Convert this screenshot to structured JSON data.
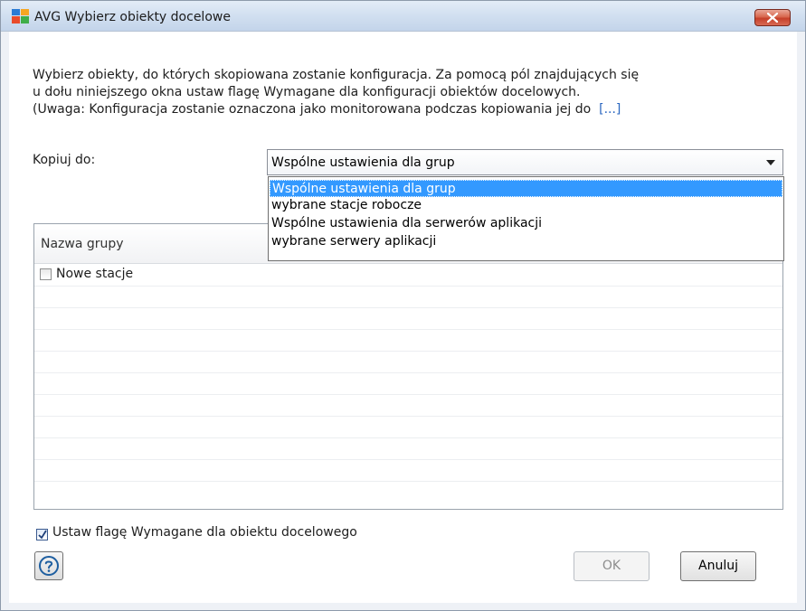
{
  "window": {
    "title": "AVG Wybierz obiekty docelowe"
  },
  "description": {
    "line1": "Wybierz obiekty, do których skopiowana zostanie konfiguracja. Za pomocą pól znajdujących się",
    "line2": "u dołu niniejszego okna ustaw flagę Wymagane dla konfiguracji obiektów docelowych.",
    "line3": "(Uwaga: Konfiguracja zostanie oznaczona jako monitorowana podczas kopiowania jej do",
    "more_link": "[...]"
  },
  "copy_to": {
    "label": "Kopiuj do:",
    "selected": "Wspólne ustawienia dla grup",
    "options": [
      "Wspólne ustawienia dla grup",
      "wybrane stacje robocze",
      "Wspólne ustawienia dla serwerów aplikacji",
      "wybrane serwery aplikacji"
    ]
  },
  "grid": {
    "column_header": "Nazwa grupy",
    "rows": [
      {
        "label": "Nowe stacje",
        "checked": false
      }
    ]
  },
  "flag_checkbox": {
    "label": "Ustaw flagę Wymagane dla obiektu docelowego",
    "checked": true
  },
  "buttons": {
    "ok": "OK",
    "cancel": "Anuluj"
  },
  "icons": {
    "app": "avg-logo-icon",
    "close": "close-icon",
    "help": "help-icon",
    "dropdown": "chevron-down-icon",
    "check": "checkmark-icon"
  },
  "colors": {
    "selection": "#3399ff",
    "close_button": "#c6402a",
    "link": "#2a66c0"
  }
}
